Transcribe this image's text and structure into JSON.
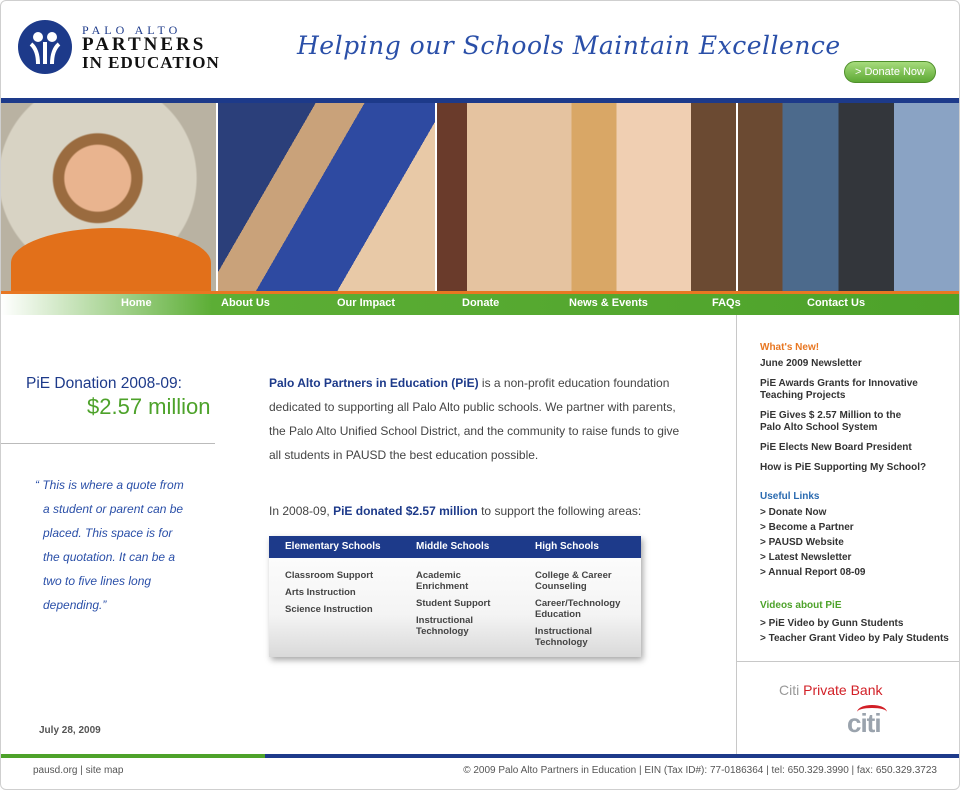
{
  "header": {
    "logo_line1": "PALO ALTO",
    "logo_line2": "PARTNERS",
    "logo_line3": "IN EDUCATION",
    "tagline": "Helping our Schools Maintain Excellence",
    "donate_button": "> Donate Now"
  },
  "nav": [
    "Home",
    "About Us",
    "Our Impact",
    "Donate",
    "News & Events",
    "FAQs",
    "Contact Us"
  ],
  "left": {
    "donation_title": "PiE Donation 2008-09:",
    "donation_amount": "$2.57 million",
    "quote": [
      "“ This is where a quote from",
      "a student or parent can be",
      "placed. This space is for",
      "the quotation. It can be a",
      "two to five lines long",
      "depending.”"
    ],
    "date": "July 28, 2009"
  },
  "main": {
    "intro_highlight": "Palo Alto Partners in Education (PiE)",
    "intro_rest": " is a non-profit education foundation dedicated to supporting all Palo Alto public schools. We partner with parents, the Palo Alto Unified School District, and the community to raise funds to give all students in PAUSD the best education possible.",
    "line2_pre": "In 2008-09, ",
    "line2_highlight": "PiE donated $2.57 million",
    "line2_post": " to support the following areas:",
    "table": {
      "headers": [
        "Elementary Schools",
        "Middle Schools",
        "High Schools"
      ],
      "col1": [
        "Classroom Support",
        "Arts Instruction",
        "Science Instruction"
      ],
      "col2": [
        "Academic Enrichment",
        "Student Support",
        "Instructional Technology"
      ],
      "col3": [
        "College & Career Counseling",
        "Career/Technology Education",
        "Instructional Technology"
      ]
    }
  },
  "sidebar": {
    "whats_new_title": "What's New!",
    "news": [
      "June 2009 Newsletter",
      "PiE Awards Grants for Innovative Teaching Projects",
      "PiE Gives $ 2.57 Million to the Palo Alto School System",
      "PiE Elects New Board President",
      "How is PiE Supporting My School?"
    ],
    "useful_links_title": "Useful Links",
    "links": [
      "> Donate Now",
      "> Become a Partner",
      "> PAUSD Website",
      "> Latest Newsletter",
      "> Annual Report 08-09"
    ],
    "videos_title": "Videos about PiE",
    "videos": [
      "> PiE Video by Gunn Students",
      "> Teacher Grant Video by Paly Students"
    ],
    "sponsor_prefix": "Citi",
    "sponsor_name": "Private Bank",
    "sponsor_logo": "citi"
  },
  "footer": {
    "left": "pausd.org | site map",
    "right": "© 2009 Palo Alto Partners in Education | EIN (Tax ID#): 77-0186364 | tel: 650.329.3990 | fax: 650.329.3723"
  },
  "colors": {
    "navy": "#1d3a8a",
    "green": "#4da22a",
    "orange": "#e87722",
    "citi_red": "#d21f26"
  }
}
